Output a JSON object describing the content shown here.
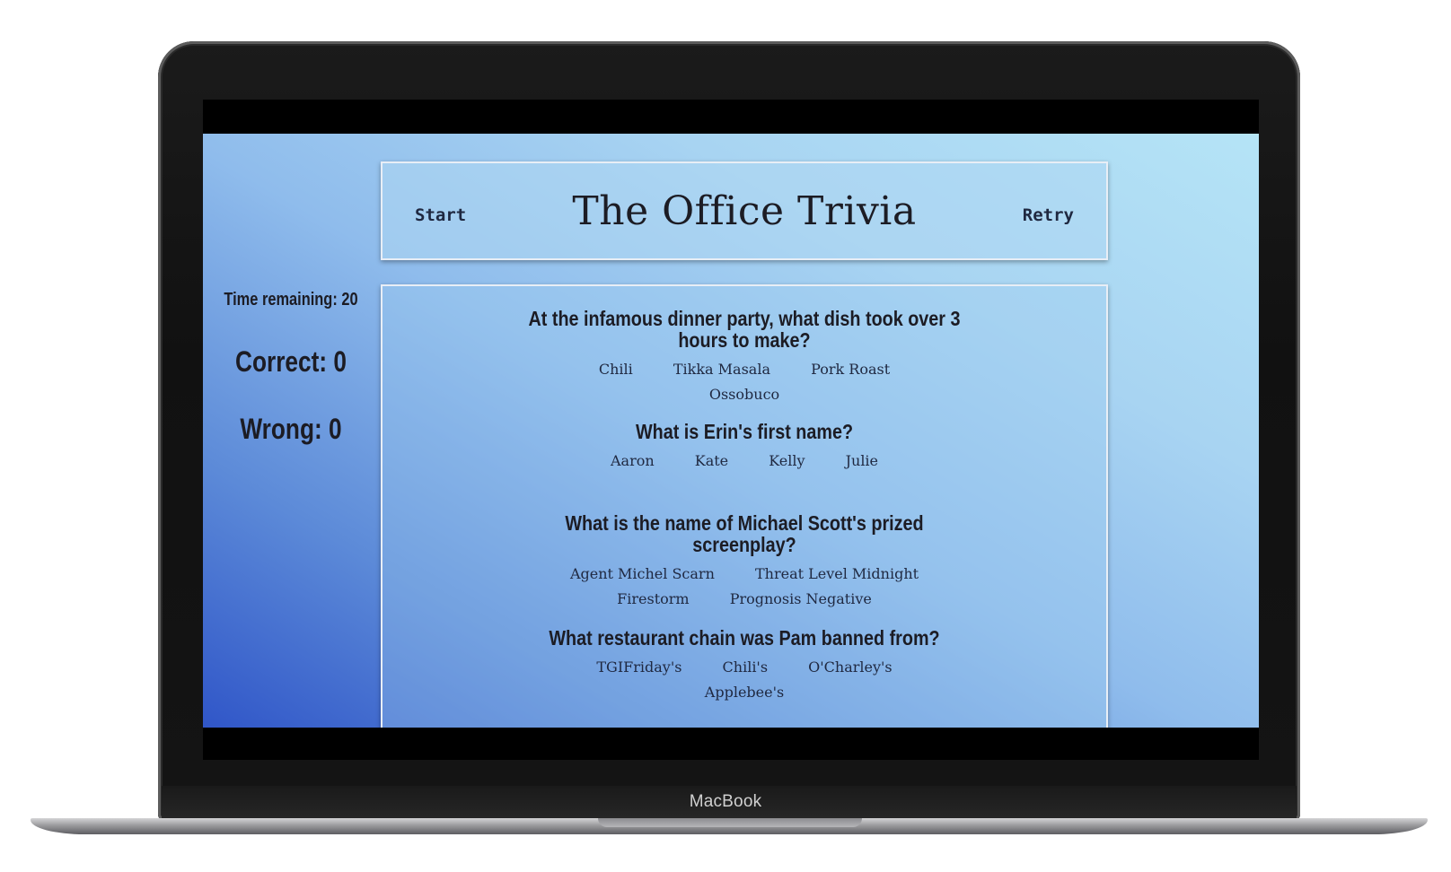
{
  "device": {
    "brand": "MacBook"
  },
  "page": {
    "title": "The Office Trivia",
    "start_label": "Start",
    "retry_label": "Retry"
  },
  "scoreboard": {
    "time": "Time remaining: 20",
    "correct": "Correct: 0",
    "wrong": "Wrong: 0"
  },
  "questions": [
    {
      "text": "At the infamous dinner party, what dish took over 3 hours to make?",
      "answers": [
        "Chili",
        "Tikka Masala",
        "Pork Roast",
        "Ossobuco"
      ]
    },
    {
      "text": "What is Erin's first name?",
      "answers": [
        "Aaron",
        "Kate",
        "Kelly",
        "Julie"
      ]
    },
    {
      "text": "What is the name of Michael Scott's prized screenplay?",
      "answers": [
        "Agent Michel Scarn",
        "Threat Level Midnight",
        "Firestorm",
        "Prognosis Negative"
      ]
    },
    {
      "text": "What restaurant chain was Pam banned from?",
      "answers": [
        "TGIFriday's",
        "Chili's",
        "O'Charley's",
        "Applebee's"
      ]
    }
  ]
}
